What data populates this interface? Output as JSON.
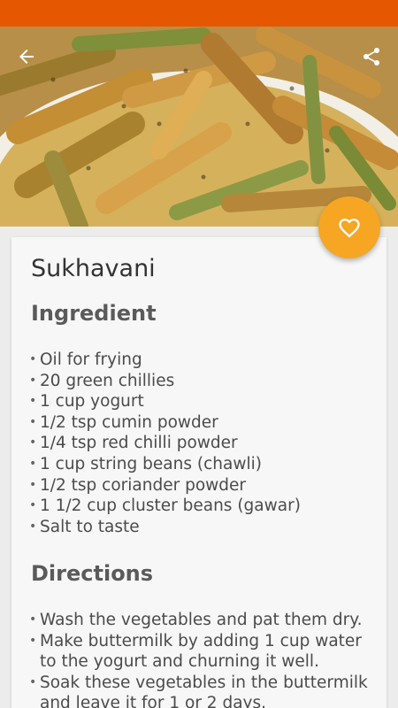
{
  "recipe": {
    "title": "Sukhavani",
    "ingredients_heading": "Ingredient",
    "ingredients": [
      "Oil for frying",
      "20 green chillies",
      "1 cup yogurt",
      "1/2 tsp cumin powder",
      "1/4 tsp red chilli powder",
      "1 cup string beans (chawli)",
      "1/2 tsp coriander powder",
      "1 1/2 cup cluster beans (gawar)",
      "Salt to taste"
    ],
    "directions_heading": "Directions",
    "directions": [
      "Wash the vegetables and pat them dry.",
      "Make buttermilk by adding 1 cup water to the yogurt and churning it well.",
      "Soak these vegetables in the buttermilk and leave it for 1 or 2 days."
    ]
  },
  "icons": {
    "back": "arrow-left-icon",
    "share": "share-icon",
    "favorite": "heart-outline-icon"
  },
  "colors": {
    "status_bar": "#e55700",
    "fab": "#f6a623"
  }
}
